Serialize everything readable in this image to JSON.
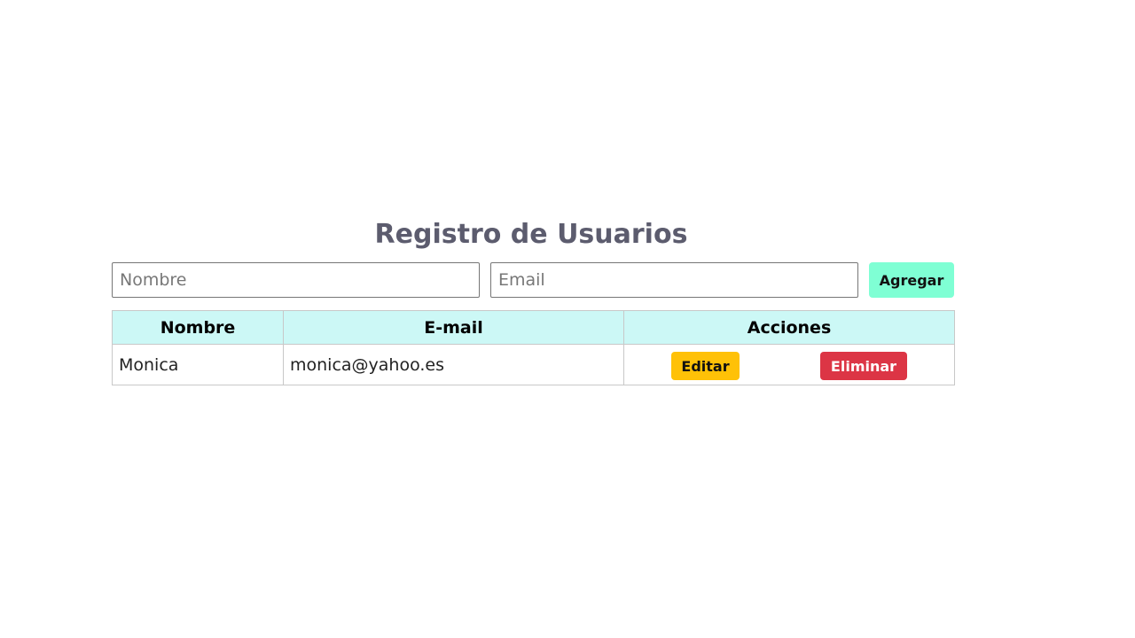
{
  "header": {
    "title": "Registro de Usuarios"
  },
  "form": {
    "nombre_placeholder": "Nombre",
    "email_placeholder": "Email",
    "add_label": "Agregar"
  },
  "table": {
    "columns": [
      "Nombre",
      "E-mail",
      "Acciones"
    ],
    "rows": [
      {
        "nombre": "Monica",
        "email": "monica@yahoo.es",
        "edit_label": "Editar",
        "delete_label": "Eliminar"
      }
    ]
  },
  "colors": {
    "title": "#5c5c6e",
    "add_button": "#7fffd4",
    "header_bg": "#ccf8f6",
    "edit_button": "#ffc107",
    "delete_button": "#dc3545"
  }
}
